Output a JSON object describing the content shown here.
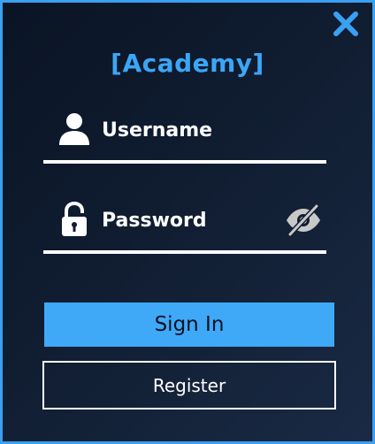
{
  "app": {
    "title": "[Academy]"
  },
  "username": {
    "placeholder": "Username",
    "value": "",
    "icon": "user-icon"
  },
  "password": {
    "placeholder": "Password",
    "value": "",
    "icon": "lock-icon",
    "toggle_icon": "eye-slash-icon"
  },
  "actions": {
    "signin_label": "Sign In",
    "register_label": "Register"
  },
  "window": {
    "close_icon": "close-icon"
  },
  "colors": {
    "accent": "#3ba6f5",
    "button_fill": "#3fa9f8",
    "background": "#101d31",
    "text": "#ffffff"
  }
}
